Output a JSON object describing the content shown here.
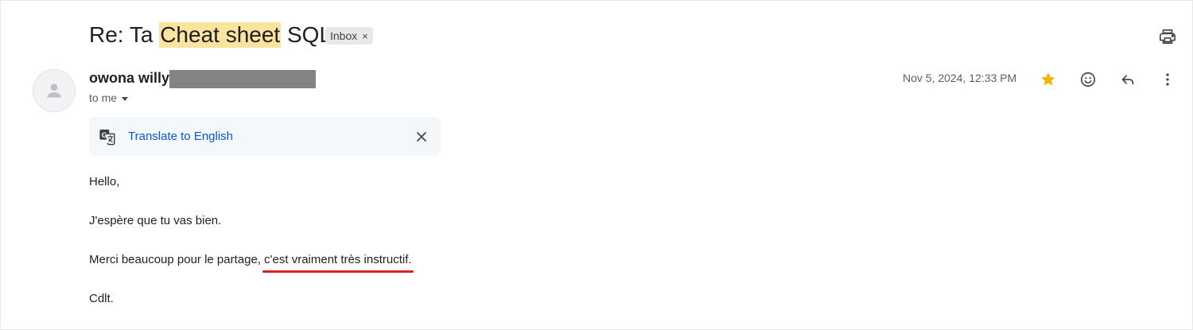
{
  "subject": {
    "prefix": "Re: Ta",
    "highlight": "Cheat sheet",
    "suffix": "SQL",
    "label": "Inbox",
    "label_remove": "×"
  },
  "sender": {
    "name": "owona willy",
    "recipient": "to me",
    "datetime": "Nov 5, 2024, 12:33 PM"
  },
  "colors": {
    "star": "#f4b400",
    "highlight": "#fbe3a0",
    "link": "#0b57d0",
    "underline_annotation": "#d32424"
  },
  "icons": [
    "print-icon",
    "person-icon",
    "star-icon",
    "emoji-icon",
    "reply-icon",
    "more-vert-icon",
    "google-translate-icon",
    "close-icon",
    "chevron-down-icon"
  ],
  "translate": {
    "link": "Translate to English",
    "close": "×"
  },
  "body": {
    "greeting": "Hello,",
    "line1": "J'espère que tu vas bien.",
    "line2_prefix": "Merci beaucoup pour le partage,",
    "line2_underlined": "c'est vraiment très instructif.",
    "signoff": "Cdlt."
  }
}
